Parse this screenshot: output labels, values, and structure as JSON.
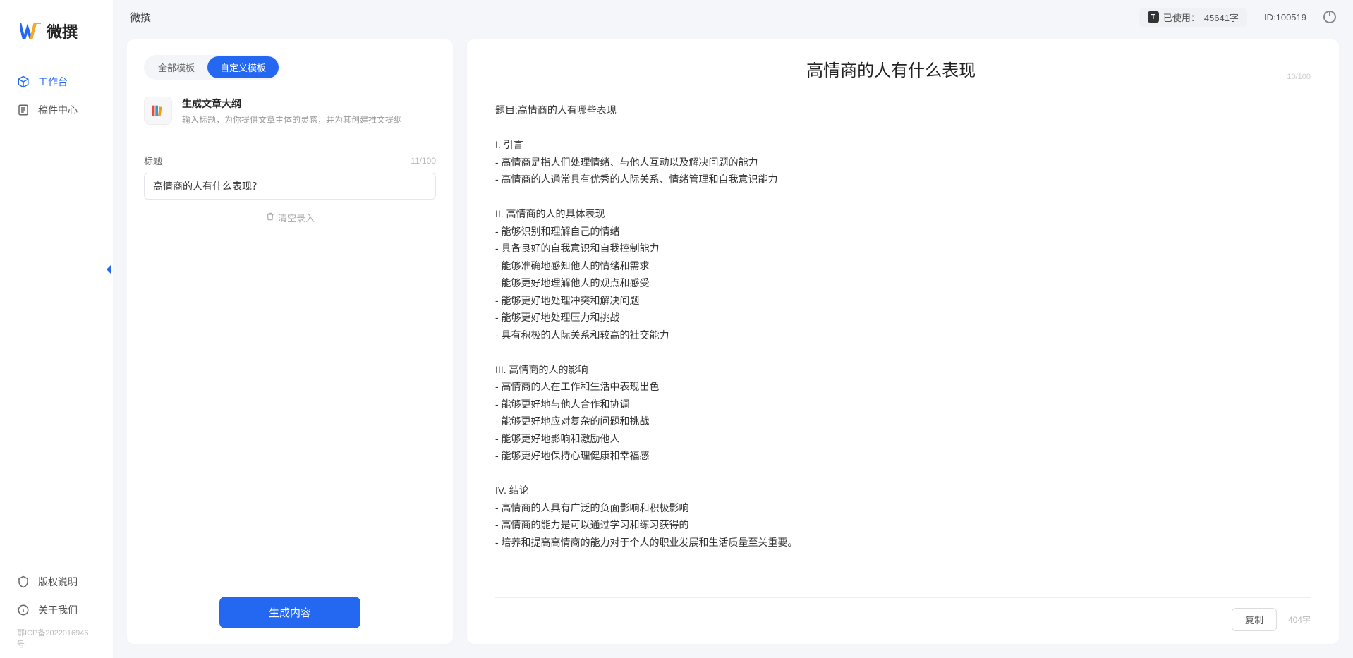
{
  "app": {
    "name": "微撰"
  },
  "header": {
    "title": "微撰",
    "usage_prefix": "已使用：",
    "usage_value": "45641字",
    "user_id_prefix": "ID:",
    "user_id": "100519"
  },
  "sidebar": {
    "logo_text": "微撰",
    "nav": [
      {
        "label": "工作台",
        "active": true
      },
      {
        "label": "稿件中心",
        "active": false
      }
    ],
    "bottom": [
      {
        "label": "版权说明"
      },
      {
        "label": "关于我们"
      }
    ],
    "icp": "鄂ICP备2022016946号"
  },
  "left_panel": {
    "tabs": [
      {
        "label": "全部模板",
        "active": false
      },
      {
        "label": "自定义模板",
        "active": true
      }
    ],
    "template": {
      "title": "生成文章大纲",
      "desc": "输入标题，为你提供文章主体的灵感，并为其创建推文提纲"
    },
    "field": {
      "label": "标题",
      "count": "11/100",
      "value": "高情商的人有什么表现？"
    },
    "clear_label": "清空录入",
    "generate_label": "生成内容"
  },
  "right_panel": {
    "title": "高情商的人有什么表现",
    "title_count": "10/100",
    "body": "题目:高情商的人有哪些表现\n\nI. 引言\n- 高情商是指人们处理情绪、与他人互动以及解决问题的能力\n- 高情商的人通常具有优秀的人际关系、情绪管理和自我意识能力\n\nII. 高情商的人的具体表现\n- 能够识别和理解自己的情绪\n- 具备良好的自我意识和自我控制能力\n- 能够准确地感知他人的情绪和需求\n- 能够更好地理解他人的观点和感受\n- 能够更好地处理冲突和解决问题\n- 能够更好地处理压力和挑战\n- 具有积极的人际关系和较高的社交能力\n\nIII. 高情商的人的影响\n- 高情商的人在工作和生活中表现出色\n- 能够更好地与他人合作和协调\n- 能够更好地应对复杂的问题和挑战\n- 能够更好地影响和激励他人\n- 能够更好地保持心理健康和幸福感\n\nIV. 结论\n- 高情商的人具有广泛的负面影响和积极影响\n- 高情商的能力是可以通过学习和练习获得的\n- 培养和提高高情商的能力对于个人的职业发展和生活质量至关重要。",
    "copy_label": "复制",
    "word_count": "404字"
  }
}
